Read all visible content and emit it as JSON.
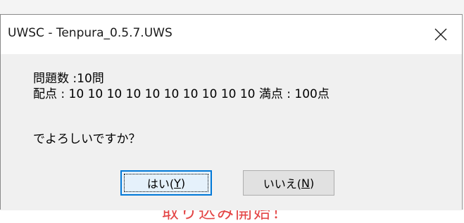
{
  "dialog": {
    "title": "UWSC - Tenpura_0.5.7.UWS",
    "message_line1": "問題数 :10問",
    "message_line2": "配点 : 10 10 10 10 10 10 10 10 10 10  満点 : 100点",
    "message_line3": "でよろしいですか？",
    "yes_button": {
      "label": "はい(",
      "mnemonic": "Y",
      "suffix": ")"
    },
    "no_button": {
      "label": "いいえ(",
      "mnemonic": "N",
      "suffix": ")"
    }
  },
  "background": {
    "partial_text": "取り込み開始！"
  },
  "colors": {
    "focus_border": "#0078d7",
    "background_text": "#e03030"
  },
  "icons": {
    "close": "close-icon"
  }
}
